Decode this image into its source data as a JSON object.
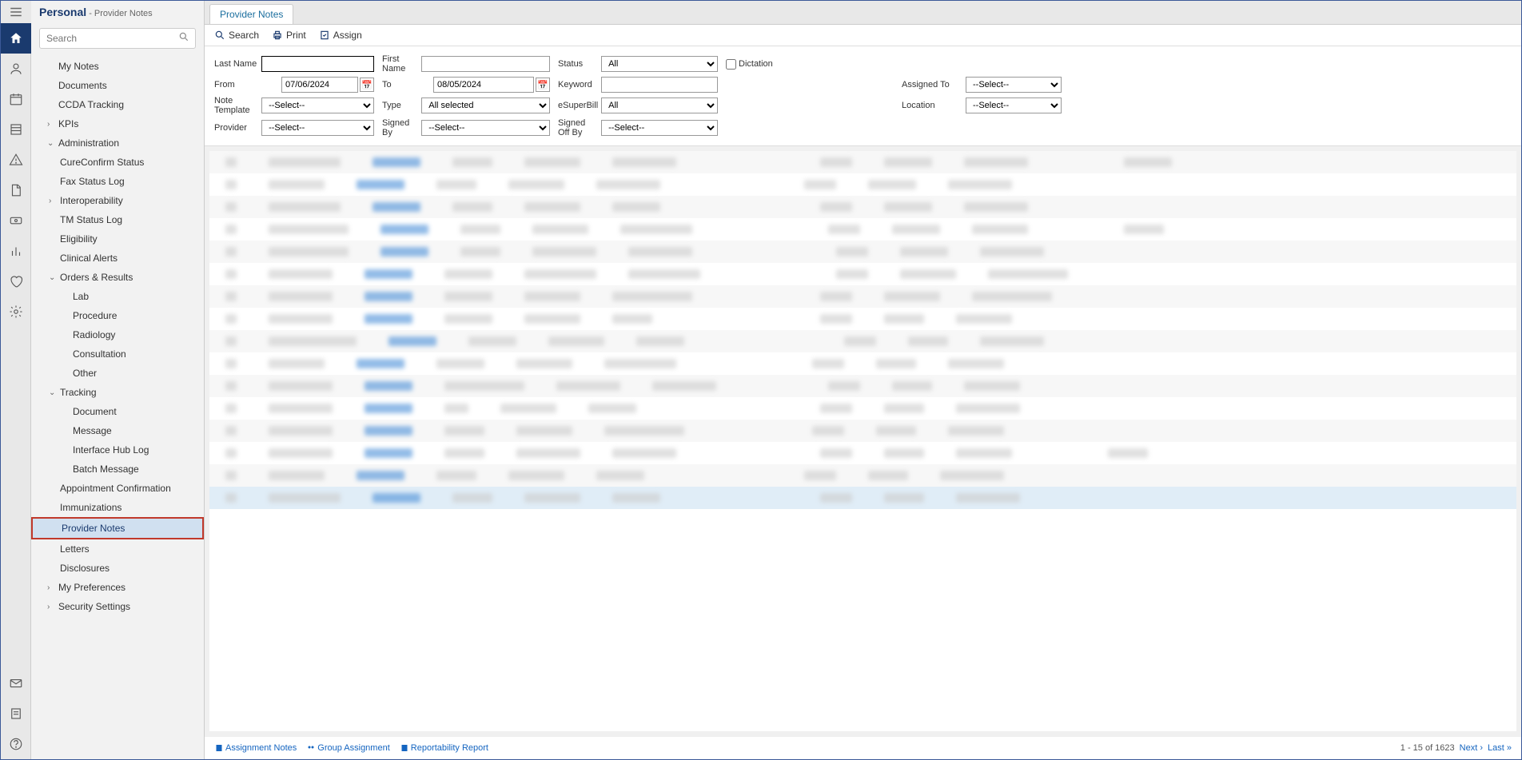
{
  "header": {
    "title": "Personal",
    "subtitle": " - Provider Notes"
  },
  "search": {
    "placeholder": "Search"
  },
  "nav": {
    "my_notes": "My Notes",
    "documents": "Documents",
    "ccda": "CCDA Tracking",
    "kpis": "KPIs",
    "admin": "Administration",
    "cureconfirm": "CureConfirm Status",
    "fax": "Fax Status Log",
    "interop": "Interoperability",
    "tm": "TM Status Log",
    "elig": "Eligibility",
    "clinical": "Clinical Alerts",
    "orders": "Orders & Results",
    "lab": "Lab",
    "procedure": "Procedure",
    "radiology": "Radiology",
    "consult": "Consultation",
    "other": "Other",
    "tracking": "Tracking",
    "document": "Document",
    "message": "Message",
    "ihub": "Interface Hub Log",
    "batch": "Batch Message",
    "appt": "Appointment Confirmation",
    "immun": "Immunizations",
    "pnotes": "Provider Notes",
    "letters": "Letters",
    "disclosures": "Disclosures",
    "prefs": "My Preferences",
    "security": "Security Settings"
  },
  "tab": {
    "label": "Provider Notes"
  },
  "toolbar": {
    "search": "Search",
    "print": "Print",
    "assign": "Assign"
  },
  "filters": {
    "last_name": "Last Name",
    "first_name": "First Name",
    "status": "Status",
    "status_val": "All",
    "dictation": "Dictation",
    "from": "From",
    "from_val": "07/06/2024",
    "to": "To",
    "to_val": "08/05/2024",
    "keyword": "Keyword",
    "assigned_to": "Assigned To",
    "assigned_val": "--Select--",
    "template": "Note Template",
    "template_val": "--Select--",
    "type": "Type",
    "type_val": "All selected",
    "esuper": "eSuperBill",
    "esuper_val": "All",
    "location": "Location",
    "location_val": "--Select--",
    "provider": "Provider",
    "provider_val": "--Select--",
    "signed_by": "Signed By",
    "signed_by_val": "--Select--",
    "signed_off": "Signed Off By",
    "signed_off_val": "--Select--"
  },
  "footer": {
    "assignment": "Assignment Notes",
    "group": "Group Assignment",
    "report": "Reportability Report",
    "range": "1 - 15 of 1623",
    "next": "Next",
    "last": "Last"
  }
}
